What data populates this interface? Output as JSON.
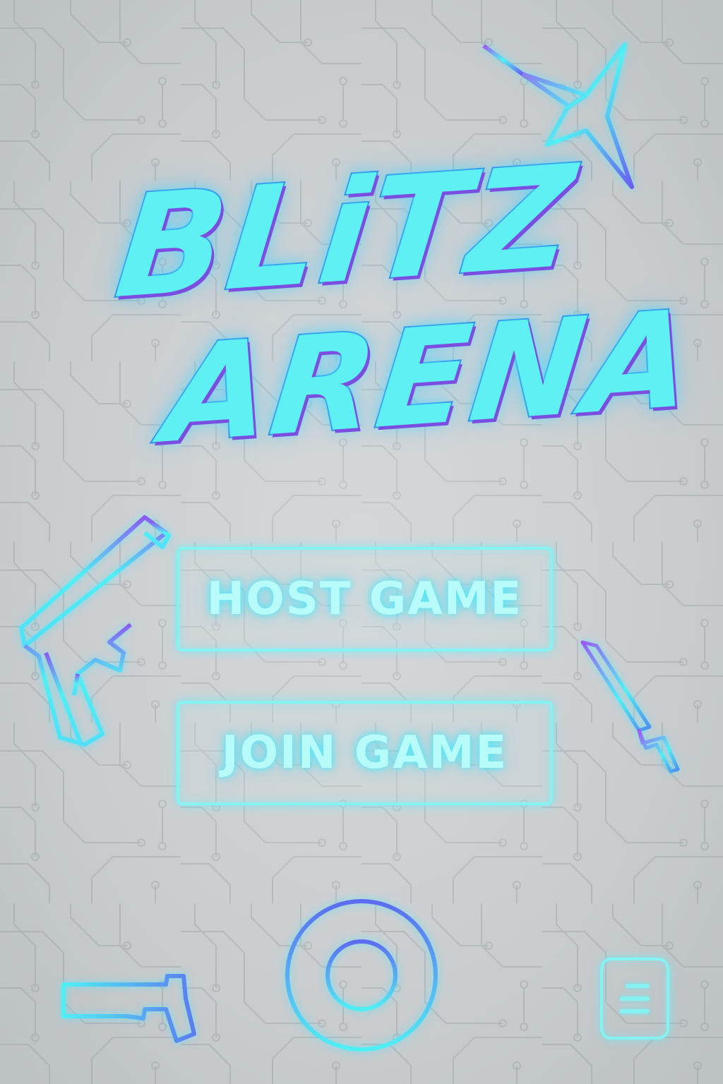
{
  "game": {
    "title_line_1": "BLiTZ",
    "title_line_2": "ARENA"
  },
  "menu": {
    "host_label": "HOST GAME",
    "join_label": "JOIN GAME"
  },
  "icons": {
    "corner_button": "menu-lines-icon",
    "decorations": [
      "ninja-star-icon",
      "pistol-icon",
      "knife-icon",
      "crosshair-icon",
      "laser-gun-icon"
    ]
  },
  "colors": {
    "background": "#c9cdcf",
    "neon_cyan": "#5ff0f4",
    "neon_blue": "#2f7fe0",
    "neon_purple": "#7a4ee0",
    "button_border": "#86f2f2",
    "button_text": "#b8fbfb"
  }
}
